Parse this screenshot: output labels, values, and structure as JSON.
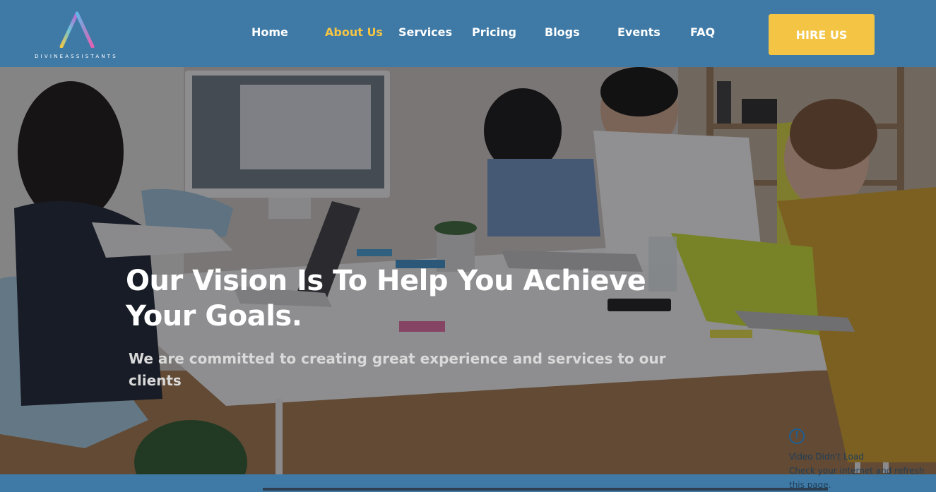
{
  "brand": {
    "name": "DIVINEASSISTANTS",
    "colors": {
      "header_bg": "#3f7aa7",
      "accent": "#f4c545",
      "text": "#ffffff"
    }
  },
  "nav": {
    "items": [
      {
        "label": "Home",
        "active": false
      },
      {
        "label": "About Us",
        "active": true
      },
      {
        "label": "Services",
        "active": false
      },
      {
        "label": "Pricing",
        "active": false
      },
      {
        "label": "Blogs",
        "active": false
      },
      {
        "label": "Events",
        "active": false
      },
      {
        "label": "FAQ",
        "active": false
      }
    ],
    "cta_label": "HIRE US"
  },
  "hero": {
    "title": "Our Vision Is To Help You Achieve Your Goals.",
    "subtitle": "We are committed to creating great experience and services to our clients",
    "background_icon": "office-meeting-photo"
  },
  "error_widget": {
    "icon": "exclamation-circle-icon",
    "title": "Video Didn't Load",
    "message": "Check your internet and refresh this page."
  }
}
